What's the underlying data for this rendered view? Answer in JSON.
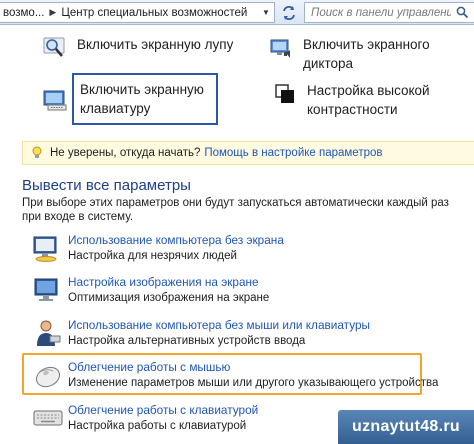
{
  "address_bar": {
    "breadcrumb": [
      "возмо...",
      "Центр специальных возможностей"
    ],
    "search_placeholder": "Поиск в панели управления"
  },
  "quick_tasks": [
    {
      "label": "Включить экранную лупу",
      "icon": "magnifier-icon"
    },
    {
      "label": "Включить экранного диктора",
      "icon": "narrator-icon"
    },
    {
      "label": "Включить экранную клавиатуру",
      "icon": "on-screen-keyboard-icon"
    },
    {
      "label": "Настройка высокой контрастности",
      "icon": "high-contrast-icon"
    }
  ],
  "hint": {
    "question": "Не уверены, откуда начать?",
    "link": "Помощь в настройке параметров"
  },
  "explore": {
    "title": "Вывести все параметры",
    "description": "При выборе этих параметров они будут запускаться автоматически каждый раз при входе в систему.",
    "options": [
      {
        "link": "Использование компьютера без экрана",
        "sub": "Настройка для незрячих людей",
        "icon": "no-display-icon"
      },
      {
        "link": "Настройка изображения на экране",
        "sub": "Оптимизация изображения на экране",
        "icon": "display-settings-icon"
      },
      {
        "link": "Использование компьютера без мыши или клавиатуры",
        "sub": "Настройка альтернативных устройств ввода",
        "icon": "alt-input-icon"
      },
      {
        "link": "Облегчение работы с мышью",
        "sub": "Изменение параметров мыши или другого указывающего устройства",
        "icon": "mouse-icon"
      },
      {
        "link": "Облегчение работы с клавиатурой",
        "sub": "Настройка работы с клавиатурой",
        "icon": "keyboard-icon"
      }
    ]
  },
  "watermark": "uznaytut48.ru",
  "colors": {
    "link": "#1f56b6",
    "title": "#1e3f8a",
    "highlight": "#f0a52e",
    "focus_border": "#2c58a8"
  }
}
